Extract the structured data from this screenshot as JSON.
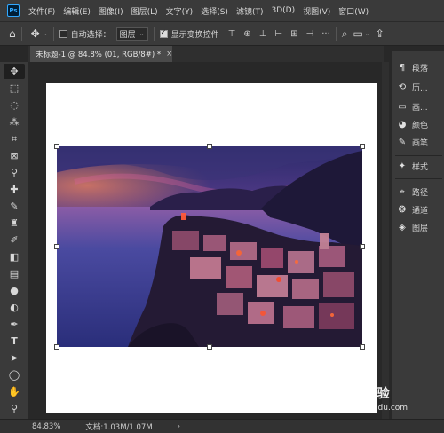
{
  "app": {
    "logo": "Ps"
  },
  "menu": [
    "文件(F)",
    "编辑(E)",
    "图像(I)",
    "图层(L)",
    "文字(Y)",
    "选择(S)",
    "滤镜(T)",
    "3D(D)",
    "视图(V)",
    "窗口(W)"
  ],
  "options": {
    "auto_select_label": "自动选择：",
    "auto_select_checked": false,
    "auto_select_target": "图层",
    "show_transform_label": "显示变换控件",
    "show_transform_checked": true
  },
  "document": {
    "tab_title": "未标题-1 @ 84.8% (01, RGB/8#) *",
    "close_glyph": "×"
  },
  "panels": {
    "group1": [
      {
        "label": "段落",
        "icon": "paragraph-icon",
        "glyph": "¶"
      },
      {
        "label": "历...",
        "icon": "history-icon",
        "glyph": "⟲"
      },
      {
        "label": "画...",
        "icon": "artboard-icon",
        "glyph": "▭"
      },
      {
        "label": "颜色",
        "icon": "color-palette-icon",
        "glyph": "◕"
      },
      {
        "label": "画笔",
        "icon": "brush-icon",
        "glyph": "✎"
      }
    ],
    "group2": [
      {
        "label": "样式",
        "icon": "styles-icon",
        "glyph": "✦"
      }
    ],
    "group3": [
      {
        "label": "路径",
        "icon": "paths-icon",
        "glyph": "⌖"
      },
      {
        "label": "通道",
        "icon": "channels-icon",
        "glyph": "❂"
      },
      {
        "label": "图层",
        "icon": "layers-icon",
        "glyph": "◈"
      }
    ]
  },
  "status": {
    "zoom": "84.83%",
    "doc_info": "文档:1.03M/1.07M",
    "arrow": "›"
  },
  "watermark": {
    "brand": "Bai du 经验",
    "url": "jingyan.baidu.com"
  },
  "colors": {
    "ui_bg": "#3a3a3a",
    "workspace_bg": "#282828",
    "accent": "#31a8ff"
  }
}
